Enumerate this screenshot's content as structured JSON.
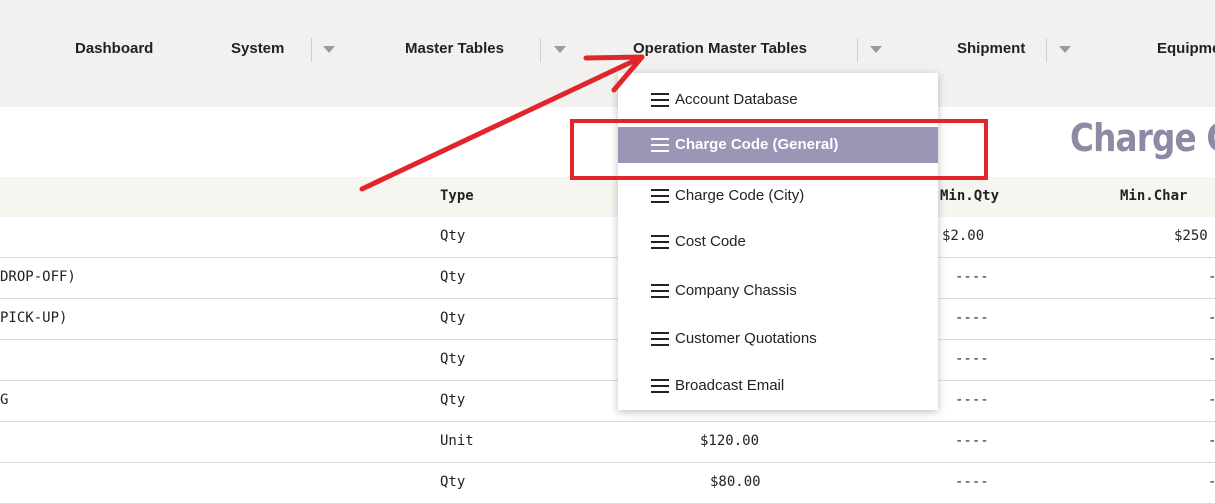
{
  "nav": {
    "items": [
      {
        "label": "Dashboard",
        "has_caret": false
      },
      {
        "label": "System",
        "has_caret": true
      },
      {
        "label": "Master Tables",
        "has_caret": true
      },
      {
        "label": "Operation Master Tables",
        "has_caret": true
      },
      {
        "label": "Shipment",
        "has_caret": true
      },
      {
        "label": "Equipme",
        "has_caret": false
      }
    ]
  },
  "page": {
    "title": "Charge Co"
  },
  "table": {
    "headers": {
      "type": "Type",
      "min_qty": "Min.Qty",
      "min_charge": "Min.Char"
    },
    "rows": [
      {
        "name": "",
        "type": "Qty",
        "rate": "",
        "min_qty": "$2.00",
        "min_charge": "$250"
      },
      {
        "name": "DROP-OFF)",
        "type": "Qty",
        "rate": "",
        "min_qty": "----",
        "min_charge": "-"
      },
      {
        "name": "PICK-UP)",
        "type": "Qty",
        "rate": "",
        "min_qty": "----",
        "min_charge": "-"
      },
      {
        "name": "",
        "type": "Qty",
        "rate": "",
        "min_qty": "----",
        "min_charge": "-"
      },
      {
        "name": "G",
        "type": "Qty",
        "rate": "",
        "min_qty": "----",
        "min_charge": "-"
      },
      {
        "name": "",
        "type": "Unit",
        "rate": "$120.00",
        "min_qty": "----",
        "min_charge": "-"
      },
      {
        "name": "",
        "type": "Qty",
        "rate": "$80.00",
        "min_qty": "----",
        "min_charge": "-"
      }
    ]
  },
  "dropdown": {
    "items": [
      {
        "label": "Account Database",
        "icon": "hamburger-icon"
      },
      {
        "label": "Charge Code (General)",
        "icon": "hamburger-icon",
        "active": true
      },
      {
        "label": "Charge Code (City)",
        "icon": "hamburger-icon"
      },
      {
        "label": "Cost Code",
        "icon": "hamburger-icon"
      },
      {
        "label": "Company Chassis",
        "icon": "hamburger-icon"
      },
      {
        "label": "Customer Quotations",
        "icon": "hamburger-icon"
      },
      {
        "label": "Broadcast Email",
        "icon": "hamburger-icon"
      }
    ]
  },
  "colors": {
    "nav_bg": "#f2f1ef",
    "active_item_bg": "#9a96b6",
    "title_color": "#8e8aa6",
    "annotation_red": "#e1262b"
  }
}
